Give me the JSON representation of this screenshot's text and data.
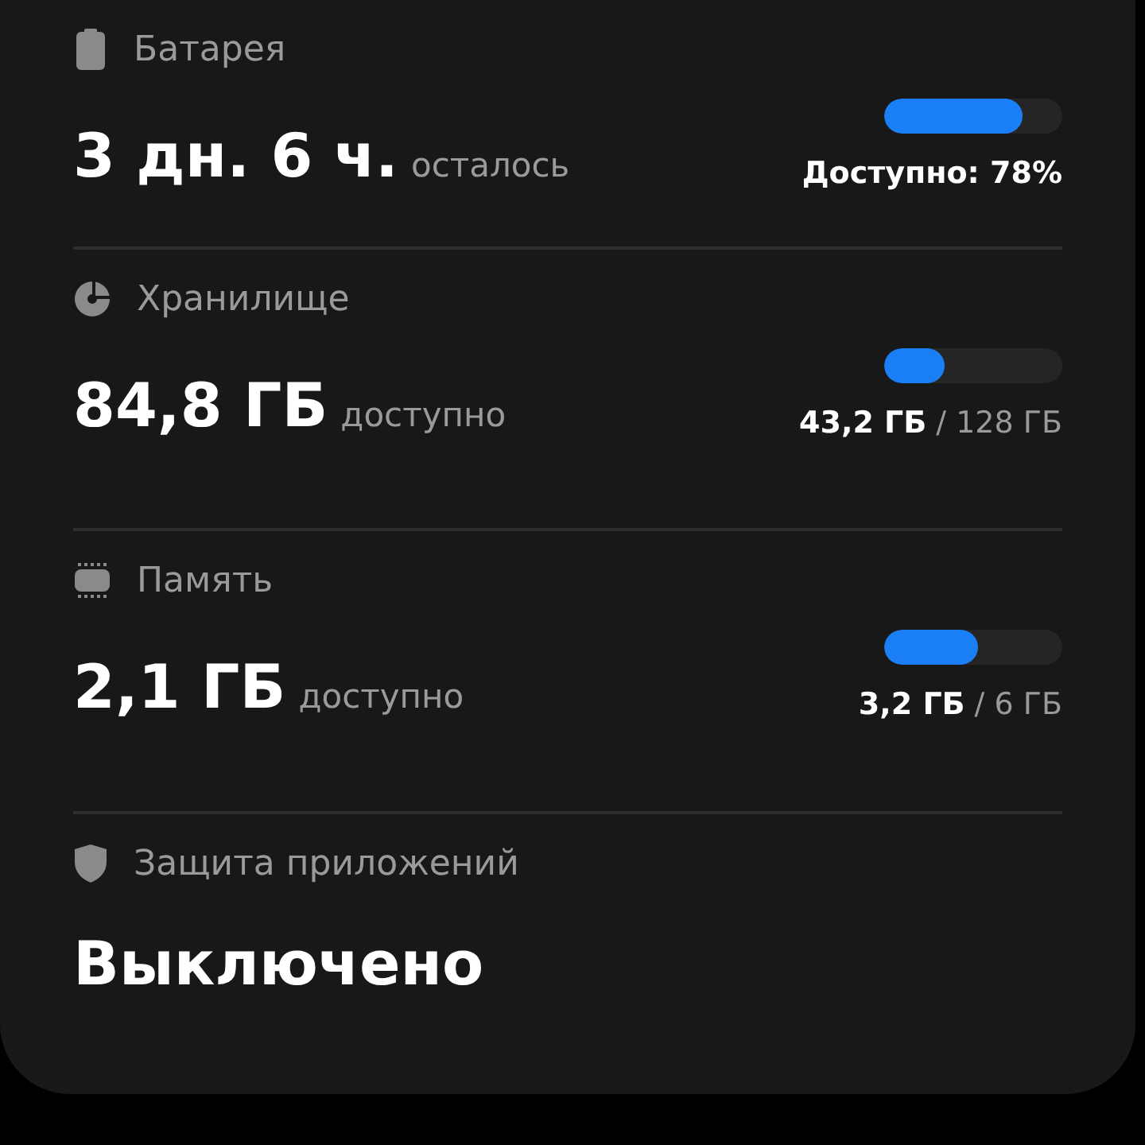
{
  "sections": [
    {
      "kind": "meter",
      "label": "Батарея",
      "value": "3 дн. 6 ч.",
      "suffix": "осталось",
      "level": 0.78,
      "used": "Доступно: 78%"
    },
    {
      "kind": "meter",
      "label": "Хранилище",
      "value": "84,8 ГБ",
      "suffix": "доступно",
      "level": 0.34,
      "used": "43,2 ГБ",
      "total": "/ 128 ГБ"
    },
    {
      "kind": "meter",
      "label": "Память",
      "value": "2,1 ГБ",
      "suffix": "доступно",
      "level": 0.53,
      "used": "3,2 ГБ",
      "total": "/ 6 ГБ"
    },
    {
      "kind": "status",
      "label": "Защита приложений",
      "value": "Выключено"
    }
  ]
}
